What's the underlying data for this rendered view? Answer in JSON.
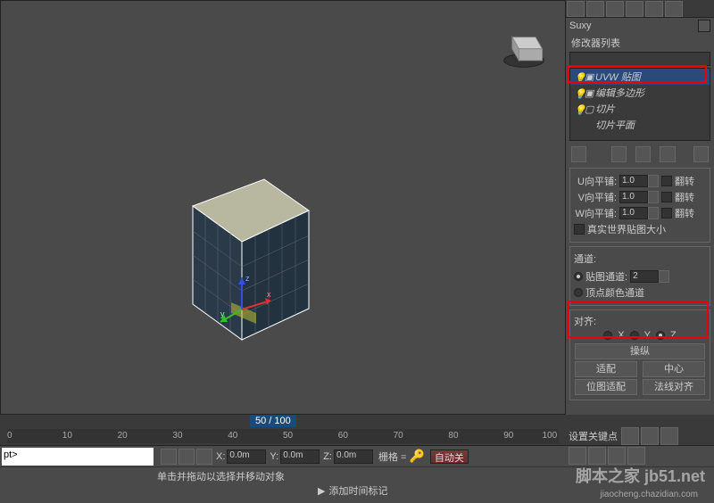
{
  "panel": {
    "title": "Suxy",
    "modifier_list_label": "修改器列表",
    "stack": {
      "uvw_map": "UVW 贴图",
      "edit_poly": "编辑多边形",
      "slice": "切片",
      "slice_plane": "切片平面"
    }
  },
  "mapping": {
    "u_tile_label": "U向平铺:",
    "v_tile_label": "V向平铺:",
    "w_tile_label": "W向平铺:",
    "u_tile": "1.0",
    "v_tile": "1.0",
    "w_tile": "1.0",
    "flip_label": "翻转",
    "real_world": "真实世界贴图大小"
  },
  "channel": {
    "label": "通道:",
    "map_channel_label": "贴图通道:",
    "map_channel_value": "2",
    "vertex_color_label": "顶点颜色通道"
  },
  "alignment": {
    "label": "对齐:",
    "x": "X",
    "y": "Y",
    "z": "Z",
    "manipulate": "操纵",
    "fit": "适配",
    "center": "中心",
    "bitmap_fit": "位图适配",
    "normal_align": "法线对齐"
  },
  "timeline": {
    "frame_label": "50 / 100",
    "ticks": [
      "0",
      "10",
      "20",
      "30",
      "40",
      "50",
      "60",
      "70",
      "80",
      "90",
      "100"
    ]
  },
  "status": {
    "script_text": "pt>",
    "x_label": "X:",
    "y_label": "Y:",
    "z_label": "Z:",
    "x_val": "0.0m",
    "y_val": "0.0m",
    "z_val": "0.0m",
    "grid_label": "栅格 =",
    "auto_key": "自动关",
    "msg": "单击并拖动以选择并移动对象",
    "add_tag": "添加时间标记",
    "set_key": "设置关键点"
  },
  "watermark": {
    "main": "脚本之家 jb51.net",
    "sub": "jiaocheng.chazidian.com"
  }
}
